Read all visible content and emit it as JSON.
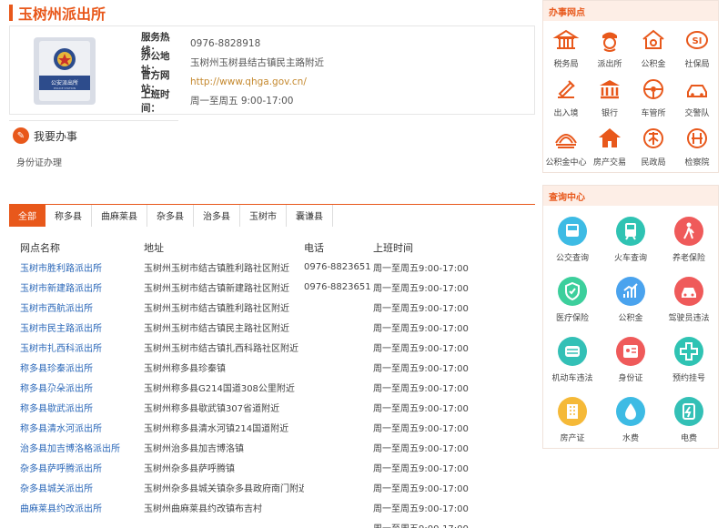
{
  "page": {
    "title": "玉树州派出所"
  },
  "info": {
    "rows": [
      {
        "key": "服务热线：",
        "value": "0976-8828918"
      },
      {
        "key": "办公地址：",
        "value": "玉树州玉树县结古镇民主路附近"
      },
      {
        "key": "官方网站：",
        "value": "http://www.qhga.gov.cn/"
      },
      {
        "key": "上班时间：",
        "value": "周一至周五 9:00-17:00"
      }
    ],
    "badge_caption": "公安派出所",
    "badge_caption_en": "POLICE STATION"
  },
  "banshi": {
    "title": "我要办事",
    "subtitle": "身份证办理"
  },
  "tabs": [
    "全部",
    "称多县",
    "曲麻莱县",
    "杂多县",
    "治多县",
    "玉树市",
    "囊谦县"
  ],
  "table": {
    "headers": [
      "网点名称",
      "地址",
      "电话",
      "上班时间"
    ],
    "rows": [
      [
        "玉树市胜利路派出所",
        "玉树州玉树市结古镇胜利路社区附近",
        "0976-8823651",
        "周一至周五9:00-17:00"
      ],
      [
        "玉树市新建路派出所",
        "玉树州玉树市结古镇新建路社区附近",
        "0976-8823651",
        "周一至周五9:00-17:00"
      ],
      [
        "玉树市西航派出所",
        "玉树州玉树市结古镇胜利路社区附近",
        "",
        "周一至周五9:00-17:00"
      ],
      [
        "玉树市民主路派出所",
        "玉树州玉树市结古镇民主路社区附近",
        "",
        "周一至周五9:00-17:00"
      ],
      [
        "玉树市扎西科派出所",
        "玉树州玉树市结古镇扎西科路社区附近",
        "",
        "周一至周五9:00-17:00"
      ],
      [
        "称多县珍秦派出所",
        "玉树州称多县珍秦镇",
        "",
        "周一至周五9:00-17:00"
      ],
      [
        "称多县尕朵派出所",
        "玉树州称多县G214国道308公里附近",
        "",
        "周一至周五9:00-17:00"
      ],
      [
        "称多县歇武派出所",
        "玉树州称多县歇武镇307省道附近",
        "",
        "周一至周五9:00-17:00"
      ],
      [
        "称多县清水河派出所",
        "玉树州称多县清水河镇214国道附近",
        "",
        "周一至周五9:00-17:00"
      ],
      [
        "治多县加吉博洛格派出所",
        "玉树州治多县加吉博洛镇",
        "",
        "周一至周五9:00-17:00"
      ],
      [
        "杂多县萨呼腾派出所",
        "玉树州杂多县萨呼腾镇",
        "",
        "周一至周五9:00-17:00"
      ],
      [
        "杂多县城关派出所",
        "玉树州杂多县城关镇杂多县政府南门附近",
        "",
        "周一至周五9:00-17:00"
      ],
      [
        "曲麻莱县约改派出所",
        "玉树州曲麻莱县约改镇布吉村",
        "",
        "周一至周五9:00-17:00"
      ],
      [
        "",
        "",
        "",
        "周一至周五9:00-17:00"
      ]
    ]
  },
  "sidebar": {
    "section1_title": "办事网点",
    "outlets": [
      {
        "label": "税务局",
        "icon": "tax-bureau-icon"
      },
      {
        "label": "派出所",
        "icon": "police-station-icon"
      },
      {
        "label": "公积金",
        "icon": "housing-fund-icon"
      },
      {
        "label": "社保局",
        "icon": "social-security-icon"
      },
      {
        "label": "出入境",
        "icon": "immigration-icon"
      },
      {
        "label": "银行",
        "icon": "bank-icon"
      },
      {
        "label": "车管所",
        "icon": "vehicle-admin-icon"
      },
      {
        "label": "交警队",
        "icon": "traffic-police-icon"
      },
      {
        "label": "公积金中心",
        "icon": "fund-center-icon"
      },
      {
        "label": "房产交易",
        "icon": "real-estate-icon"
      },
      {
        "label": "民政局",
        "icon": "civil-affairs-icon"
      },
      {
        "label": "检察院",
        "icon": "procuratorate-icon"
      }
    ],
    "section2_title": "查询中心",
    "queries": [
      {
        "label": "公交查询",
        "icon": "bus-icon",
        "color": "#3dbbe4"
      },
      {
        "label": "火车查询",
        "icon": "train-icon",
        "color": "#2fc3b3"
      },
      {
        "label": "养老保险",
        "icon": "elderly-icon",
        "color": "#ef5a5a"
      },
      {
        "label": "医疗保险",
        "icon": "medical-icon",
        "color": "#3ccf9c"
      },
      {
        "label": "公积金",
        "icon": "chart-icon",
        "color": "#4aa3ee"
      },
      {
        "label": "驾驶员违法",
        "icon": "car-icon",
        "color": "#ef5a5a"
      },
      {
        "label": "机动车违法",
        "icon": "motor-icon",
        "color": "#33c0b6"
      },
      {
        "label": "身份证",
        "icon": "id-card-icon",
        "color": "#ef5a5a"
      },
      {
        "label": "预约挂号",
        "icon": "hospital-icon",
        "color": "#2fc3b3"
      },
      {
        "label": "房产证",
        "icon": "building-icon",
        "color": "#f5b938"
      },
      {
        "label": "水费",
        "icon": "water-icon",
        "color": "#3dbbe4"
      },
      {
        "label": "电费",
        "icon": "electricity-icon",
        "color": "#33c0b6"
      }
    ]
  },
  "colors": {
    "accent": "#e8581b",
    "link": "#2a67b8"
  }
}
